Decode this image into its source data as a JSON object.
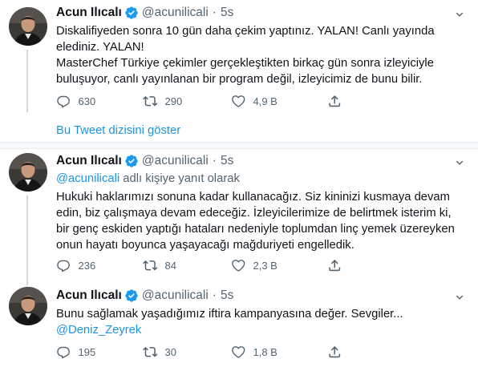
{
  "user": {
    "name": "Acun Ilıcalı",
    "handle": "@acunilicali",
    "separator": "·"
  },
  "colors": {
    "link": "#1b95e0",
    "verified": "#1d9bf0",
    "muted": "#536471"
  },
  "tweets": [
    {
      "time": "5s",
      "lines": [
        "Diskalifiyeden sonra 10 gün daha çekim yaptınız. YALAN! Canlı yayında",
        "elediniz. YALAN!",
        "MasterChef Türkiye çekimler gerçekleştikten birkaç gün sonra izleyiciyle",
        "buluşuyor, canlı yayınlanan bir program değil, izleyicimiz de bunu bilir."
      ],
      "stats": {
        "replies": "630",
        "retweets": "290",
        "likes": "4,9 B"
      },
      "show_thread": "Bu Tweet dizisini göster"
    },
    {
      "time": "5s",
      "replying_mention": "@acunilicali",
      "replying_text": " adlı kişiye yanıt olarak",
      "lines": [
        "Hukuki haklarımızı sonuna kadar kullanacağız. Siz kininizi kusmaya devam",
        "edin, biz çalışmaya devam edeceğiz. İzleyicilerimize de belirtmek isterim ki,",
        "bir genç eskiden yaptığı hataları nedeniyle toplumdan linç yemek üzereyken",
        "onun hayatı boyunca yaşayacağı mağduriyeti engelledik."
      ],
      "stats": {
        "replies": "236",
        "retweets": "84",
        "likes": "2,3 B"
      }
    },
    {
      "time": "5s",
      "lines": [
        "Bunu sağlamak yaşadığımız iftira kampanyasına değer. Sevgiler..."
      ],
      "mention_line": "@Deniz_Zeyrek",
      "stats": {
        "replies": "195",
        "retweets": "30",
        "likes": "1,8 B"
      }
    }
  ]
}
